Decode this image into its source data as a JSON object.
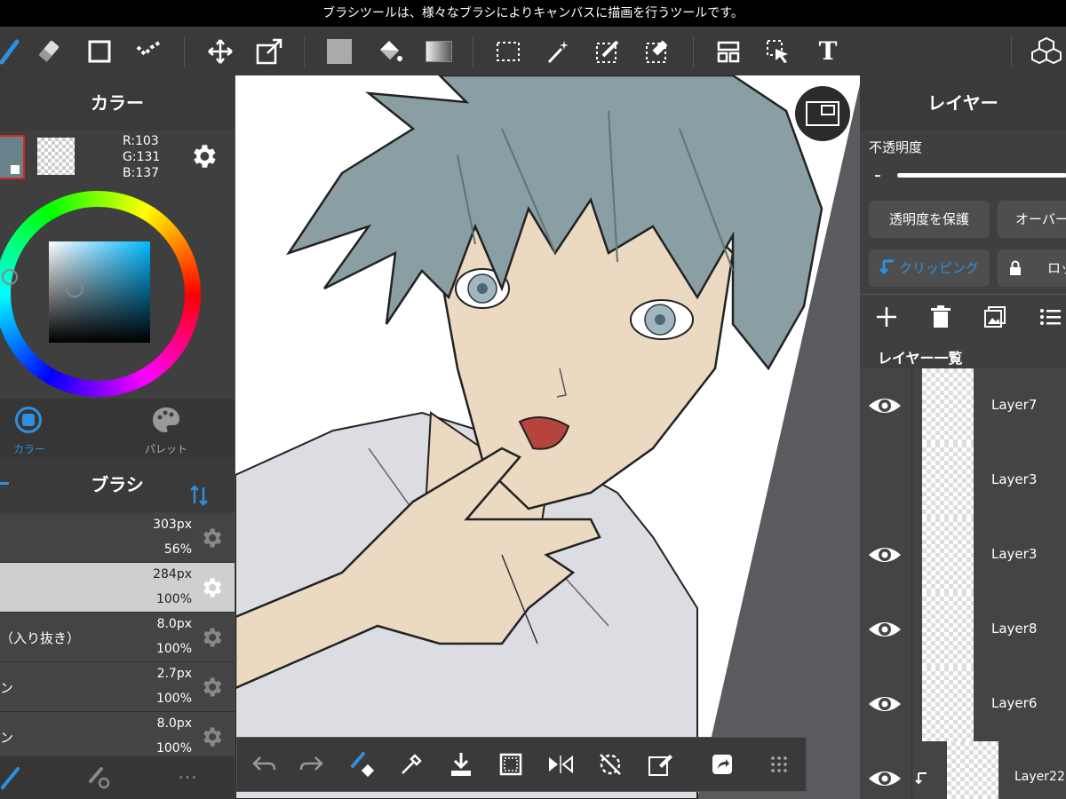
{
  "status_bar": {
    "message": "ブラシツールは、様々なブラシによりキャンバスに描画を行うツールです。"
  },
  "toolbar": {
    "tools": [
      "brush-icon",
      "eraser-icon",
      "square-icon",
      "dot-tool-icon",
      "move-icon",
      "transform-icon",
      "fill-color-icon",
      "bucket-icon",
      "gradient-icon",
      "select-rect-icon",
      "magic-wand-icon",
      "select-pen-icon",
      "select-eraser-icon",
      "layout-icon",
      "select-move-icon",
      "text-icon",
      "material-icon"
    ],
    "text_label": "T"
  },
  "color_panel": {
    "title": "カラー",
    "r": "R:103",
    "g": "G:131",
    "b": "B:137",
    "current_color": "#678389",
    "tabs": [
      {
        "label": "カラー",
        "active": true
      },
      {
        "label": "パレット",
        "active": false
      }
    ]
  },
  "brush_panel": {
    "title": "ブラシ",
    "items": [
      {
        "name": "",
        "size": "303px",
        "opacity": "56%",
        "selected": false
      },
      {
        "name": "",
        "size": "284px",
        "opacity": "100%",
        "selected": true
      },
      {
        "name": "（入り抜き）",
        "size": "8.0px",
        "opacity": "100%",
        "selected": false
      },
      {
        "name": "ン",
        "size": "2.7px",
        "opacity": "100%",
        "selected": false
      },
      {
        "name": "ン",
        "size": "8.0px",
        "opacity": "100%",
        "selected": false
      }
    ],
    "more": "…"
  },
  "layer_panel": {
    "title": "レイヤー",
    "opacity_label": "不透明度",
    "opacity_minus": "-",
    "opacity_value": 0.95,
    "protect_alpha": "透明度を保護",
    "blend_mode": "オーバーレイ",
    "clipping": "クリッピング",
    "lock": "ロック",
    "list_title": "レイヤー一覧",
    "layers": [
      {
        "name": "Layer7",
        "visible": true,
        "clipped": false
      },
      {
        "name": "Layer3",
        "visible": false,
        "clipped": false
      },
      {
        "name": "Layer3",
        "visible": true,
        "clipped": false
      },
      {
        "name": "Layer8",
        "visible": true,
        "clipped": false
      },
      {
        "name": "Layer6",
        "visible": true,
        "clipped": false
      },
      {
        "name": "Layer22",
        "visible": true,
        "clipped": true
      }
    ]
  },
  "colors": {
    "accent": "#2f8fdc",
    "hair": "#8a9fa3",
    "skin": "#ecd9c2"
  }
}
